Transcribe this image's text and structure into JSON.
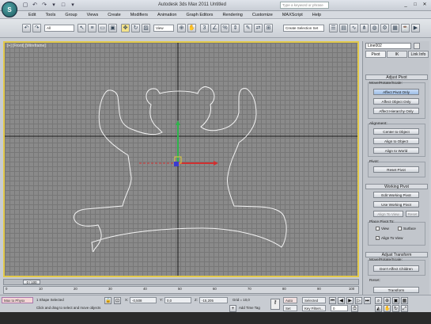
{
  "app": {
    "logo_label": "S",
    "title": "Autodesk 3ds Max 2011   Untitled",
    "search_placeholder": "Type a keyword or phrase"
  },
  "window_buttons": [
    "_",
    "□",
    "✕"
  ],
  "quick_access": [
    "▢",
    "↶",
    "↷",
    "▾",
    "□",
    "▾"
  ],
  "menu": [
    "Edit",
    "Tools",
    "Group",
    "Views",
    "Create",
    "Modifiers",
    "Animation",
    "Graph Editors",
    "Rendering",
    "Customize",
    "MAXScript",
    "Help"
  ],
  "toolbar": {
    "selection_filter": "All",
    "reference_coord": "View",
    "named_selection": "Create Selection Set"
  },
  "viewport": {
    "label": "[+] [Front] [Wireframe]",
    "border_color": "#e2c94a"
  },
  "command_panel": {
    "object_name": "Line002",
    "tabs": [
      "Pivot",
      "IK",
      "Link Info"
    ],
    "rollout_adjust_pivot": "Adjust Pivot",
    "move_rotate_scale": "Move/Rotate/Scale:",
    "btn_affect_pivot": "Affect Pivot Only",
    "btn_affect_object": "Affect Object Only",
    "btn_affect_hierarchy": "Affect Hierarchy Only",
    "alignment_label": "Alignment:",
    "btn_center": "Center to Object",
    "btn_align_object": "Align to Object",
    "btn_align_world": "Align to World",
    "pivot_label": "Pivot:",
    "btn_reset_pivot": "Reset Pivot",
    "rollout_working_pivot": "Working Pivot",
    "btn_edit_working": "Edit Working Pivot",
    "btn_use_working": "Use Working Pivot",
    "btn_align_to_view": "Align To View",
    "btn_reset": "Reset",
    "place_pivot_label": "Place Pivot To:",
    "chk_view": "View",
    "chk_surface": "Surface",
    "chk_align_view": "Align To View",
    "rollout_adjust_transform": "Adjust Transform",
    "move_rotate_scale_2": "Move/Rotate/Scale:",
    "btn_dont_affect": "Don't Affect Children",
    "reset_label": "Reset:",
    "btn_transform": "Transform"
  },
  "time_slider": {
    "label": "0 / 100"
  },
  "trackbar_ticks": [
    "0",
    "10",
    "20",
    "30",
    "40",
    "50",
    "60",
    "70",
    "80",
    "90",
    "100"
  ],
  "status": {
    "max_to_physx": "Max to Physx",
    "selected": "1 Shape Selected",
    "prompt": "Click and drag to select and move objects",
    "x_label": "X:",
    "x_value": "-0,508",
    "y_label": "Y:",
    "y_value": "0,0",
    "z_label": "Z:",
    "z_value": "-15,205",
    "grid": "Grid = 10,0",
    "add_time_tag": "Add Time Tag",
    "auto_key": "Auto Key",
    "set_key": "Set Key",
    "selected_dropdown": "Selected",
    "key_filters": "Key Filters...",
    "frame": "0"
  }
}
